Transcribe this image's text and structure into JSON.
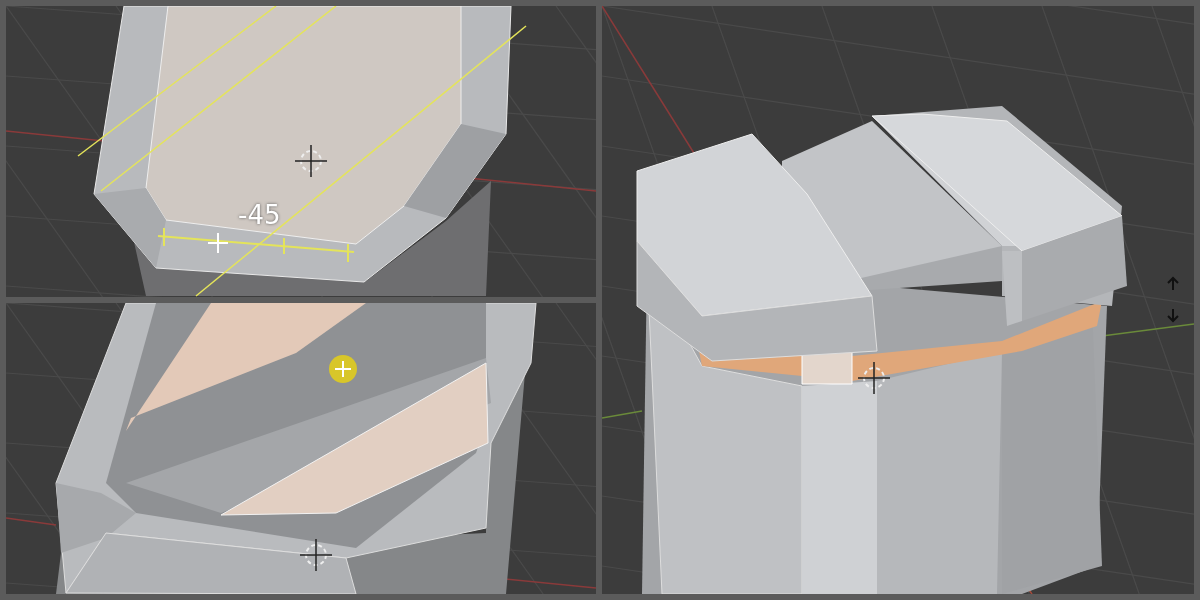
{
  "viewports": [
    {
      "kind": "rim-cut",
      "readout": "-45"
    },
    {
      "kind": "strips"
    },
    {
      "kind": "box"
    }
  ]
}
